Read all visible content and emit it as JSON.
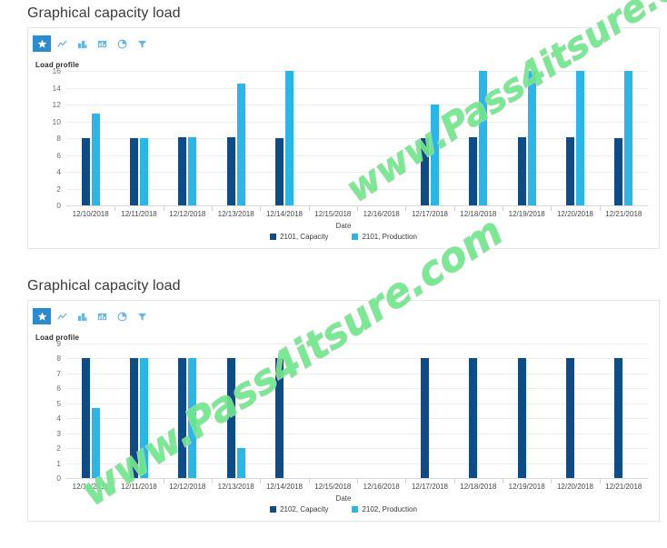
{
  "watermark": {
    "text": "www.Pass4itsure.com",
    "color": "#6ee88a"
  },
  "colors": {
    "capacity": "#0d4c87",
    "production": "#29b6e8",
    "toolbar_active": "#2a8bd0",
    "toolbar_icon": "#6ab4e0"
  },
  "panels": [
    {
      "title": "Graphical capacity load",
      "section_label": "Load profile",
      "toolbar": [
        {
          "name": "favorite-star-icon",
          "label": "Favorite",
          "active": true
        },
        {
          "name": "line-chart-icon",
          "label": "Line chart",
          "active": false
        },
        {
          "name": "bar-chart-icon",
          "label": "Bar chart",
          "active": false
        },
        {
          "name": "column-chart-icon",
          "label": "Column chart",
          "active": false
        },
        {
          "name": "pie-chart-icon",
          "label": "Pie chart",
          "active": false
        },
        {
          "name": "filter-icon",
          "label": "Filter",
          "active": false
        }
      ],
      "chart_data": {
        "type": "bar",
        "title": "Load profile",
        "xlabel": "Date",
        "ylabel": "",
        "ylim": [
          0,
          16
        ],
        "yticks": [
          0,
          2,
          4,
          6,
          8,
          10,
          12,
          14,
          16
        ],
        "grid": true,
        "legend_position": "bottom",
        "categories": [
          "12/10/2018",
          "12/11/2018",
          "12/12/2018",
          "12/13/2018",
          "12/14/2018",
          "12/15/2018",
          "12/16/2018",
          "12/17/2018",
          "12/18/2018",
          "12/19/2018",
          "12/20/2018",
          "12/21/2018"
        ],
        "series": [
          {
            "name": "2101, Capacity",
            "color": "#0d4c87",
            "values": [
              8,
              8,
              8.1,
              8.1,
              8,
              0,
              0,
              8,
              8.1,
              8.1,
              8.1,
              8
            ]
          },
          {
            "name": "2101, Production",
            "color": "#29b6e8",
            "values": [
              10.9,
              8,
              8.1,
              14.5,
              16,
              0,
              0,
              12,
              16,
              16,
              16,
              16
            ]
          }
        ]
      }
    },
    {
      "title": "Graphical capacity load",
      "section_label": "Load profile",
      "toolbar": [
        {
          "name": "favorite-star-icon",
          "label": "Favorite",
          "active": true
        },
        {
          "name": "line-chart-icon",
          "label": "Line chart",
          "active": false
        },
        {
          "name": "bar-chart-icon",
          "label": "Bar chart",
          "active": false
        },
        {
          "name": "column-chart-icon",
          "label": "Column chart",
          "active": false
        },
        {
          "name": "pie-chart-icon",
          "label": "Pie chart",
          "active": false
        },
        {
          "name": "filter-icon",
          "label": "Filter",
          "active": false
        }
      ],
      "chart_data": {
        "type": "bar",
        "title": "Load profile",
        "xlabel": "Date",
        "ylabel": "",
        "ylim": [
          0,
          9
        ],
        "yticks": [
          0,
          1,
          2,
          3,
          4,
          5,
          6,
          7,
          8,
          9
        ],
        "grid": true,
        "legend_position": "bottom",
        "categories": [
          "12/10/2018",
          "12/11/2018",
          "12/12/2018",
          "12/13/2018",
          "12/14/2018",
          "12/15/2018",
          "12/16/2018",
          "12/17/2018",
          "12/18/2018",
          "12/19/2018",
          "12/20/2018",
          "12/21/2018"
        ],
        "series": [
          {
            "name": "2102, Capacity",
            "color": "#0d4c87",
            "values": [
              8,
              8,
              8,
              8,
              8,
              0,
              0,
              8,
              8,
              8,
              8,
              8
            ]
          },
          {
            "name": "2102, Production",
            "color": "#29b6e8",
            "values": [
              4.7,
              8,
              8,
              2,
              0,
              0,
              0,
              0,
              0,
              0,
              0,
              0
            ]
          }
        ]
      }
    }
  ]
}
